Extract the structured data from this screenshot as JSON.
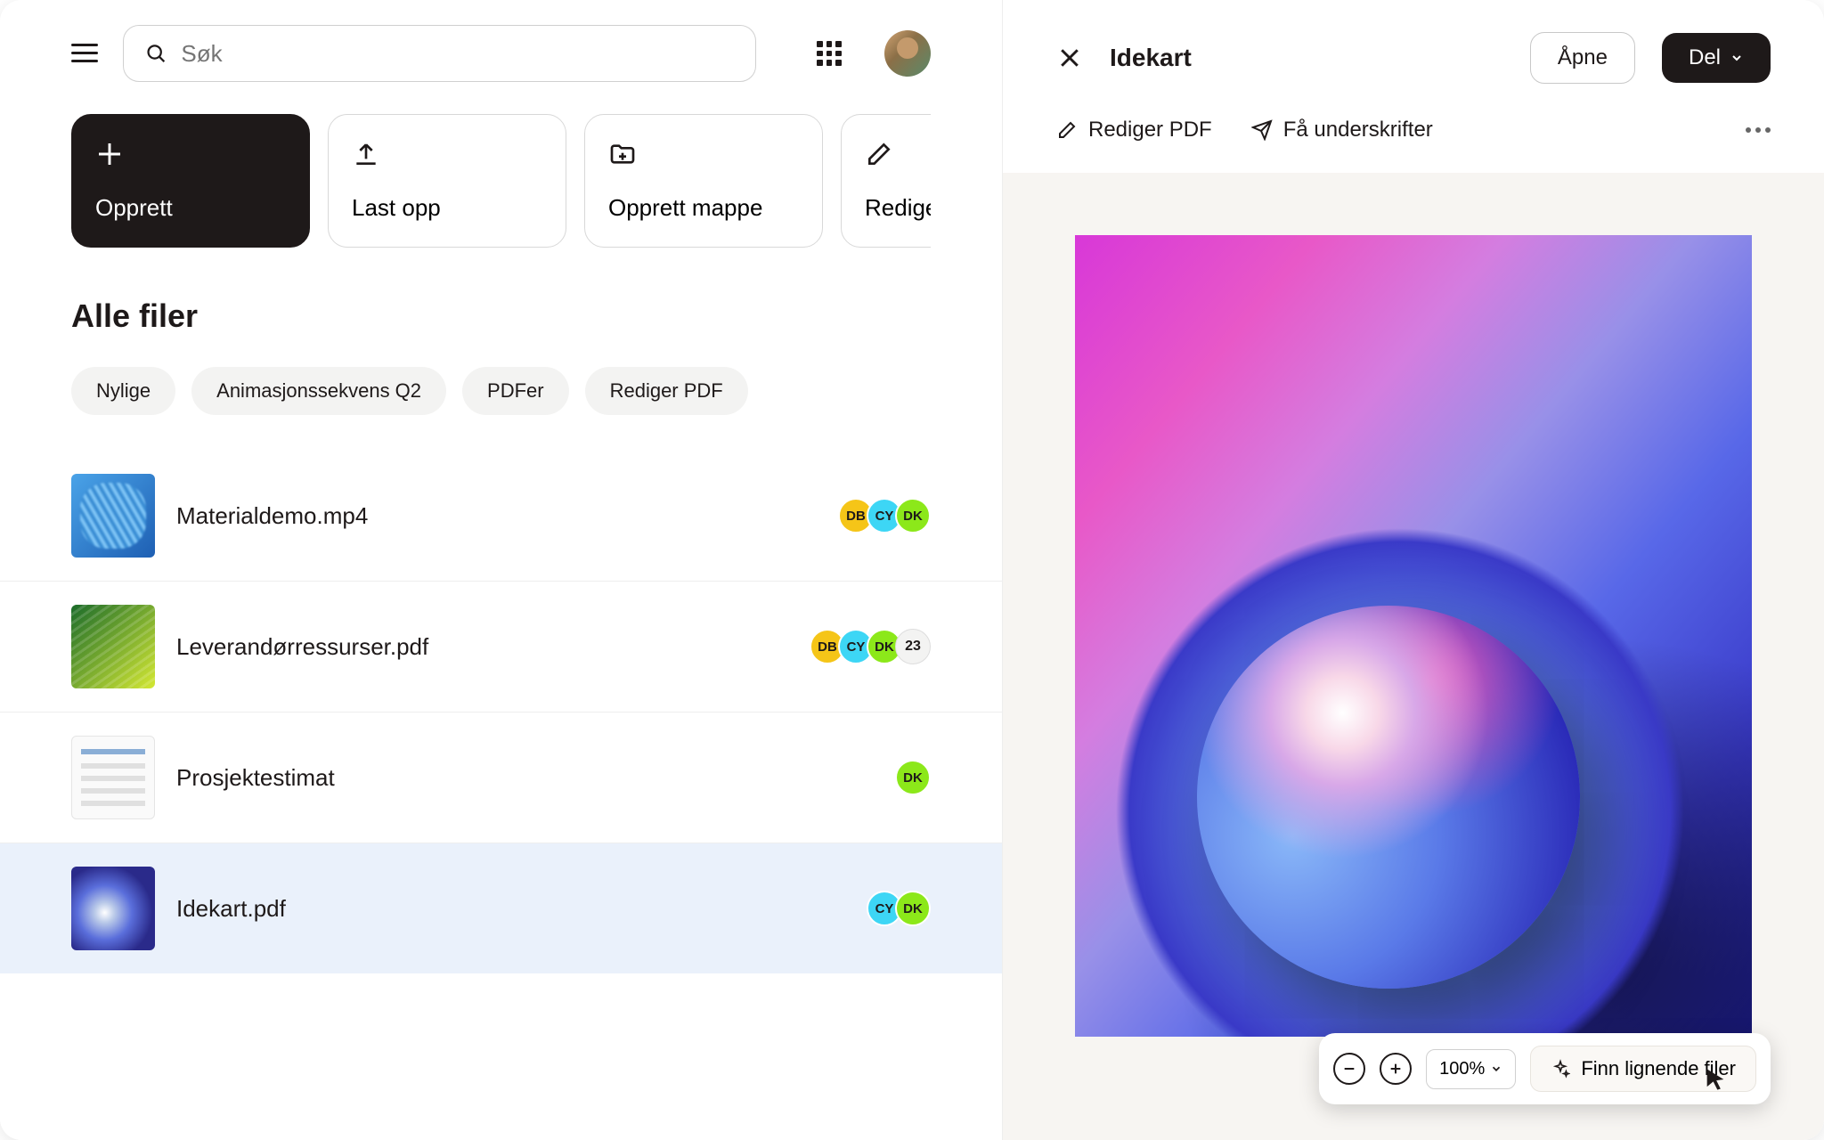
{
  "search": {
    "placeholder": "Søk"
  },
  "actions": {
    "create": "Opprett",
    "upload": "Last opp",
    "create_folder": "Opprett mappe",
    "edit_pdf": "Rediger PDF"
  },
  "section_title": "Alle filer",
  "chips": [
    "Nylige",
    "Animasjonssekvens Q2",
    "PDFer",
    "Rediger PDF"
  ],
  "files": [
    {
      "name": "Materialdemo.mp4",
      "shares": [
        "DB",
        "CY",
        "DK"
      ],
      "extra": null
    },
    {
      "name": "Leverandørressurser.pdf",
      "shares": [
        "DB",
        "CY",
        "DK"
      ],
      "extra": "23"
    },
    {
      "name": "Prosjektestimat",
      "shares": [
        "DK"
      ],
      "extra": null
    },
    {
      "name": "Idekart.pdf",
      "shares": [
        "CY",
        "DK"
      ],
      "extra": null
    }
  ],
  "detail": {
    "title": "Idekart",
    "open": "Åpne",
    "share": "Del",
    "edit_pdf": "Rediger PDF",
    "get_signatures": "Få underskrifter"
  },
  "toolbar": {
    "zoom": "100%",
    "find_similar": "Finn lignende filer"
  },
  "badge_colors": {
    "DB": "orange",
    "CY": "cyan",
    "DK": "green"
  }
}
